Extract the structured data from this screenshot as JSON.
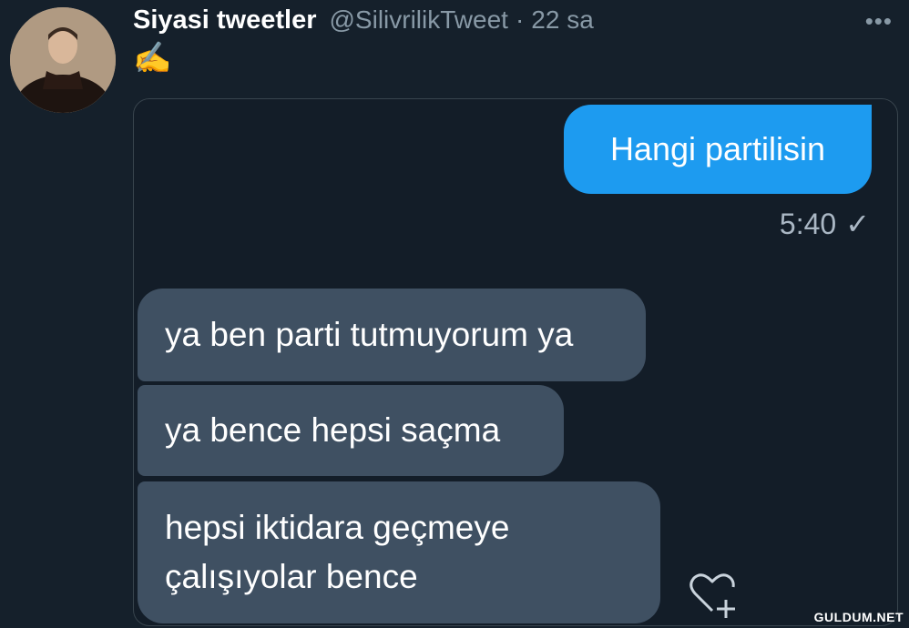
{
  "tweet": {
    "display_name": "Siyasi tweetler",
    "handle": "@SilivrilikTweet",
    "separator": "·",
    "time": "22 sa",
    "more": "•••",
    "text": "✍️"
  },
  "screenshot": {
    "outgoing_message": "Hangi partilisin",
    "outgoing_time": "5:40",
    "read_mark": "✓",
    "incoming_messages": [
      "ya ben parti tutmuyorum ya",
      "ya bence hepsi saçma",
      "hepsi iktidara geçmeye çalışıyolar bence"
    ],
    "reaction_icon": "heart-add-icon"
  },
  "watermark": "GULDUM.NET",
  "colors": {
    "background": "#15202b",
    "outgoing_bubble": "#1d9bf0",
    "incoming_bubble": "#3f5062",
    "secondary_text": "#8899a6"
  }
}
